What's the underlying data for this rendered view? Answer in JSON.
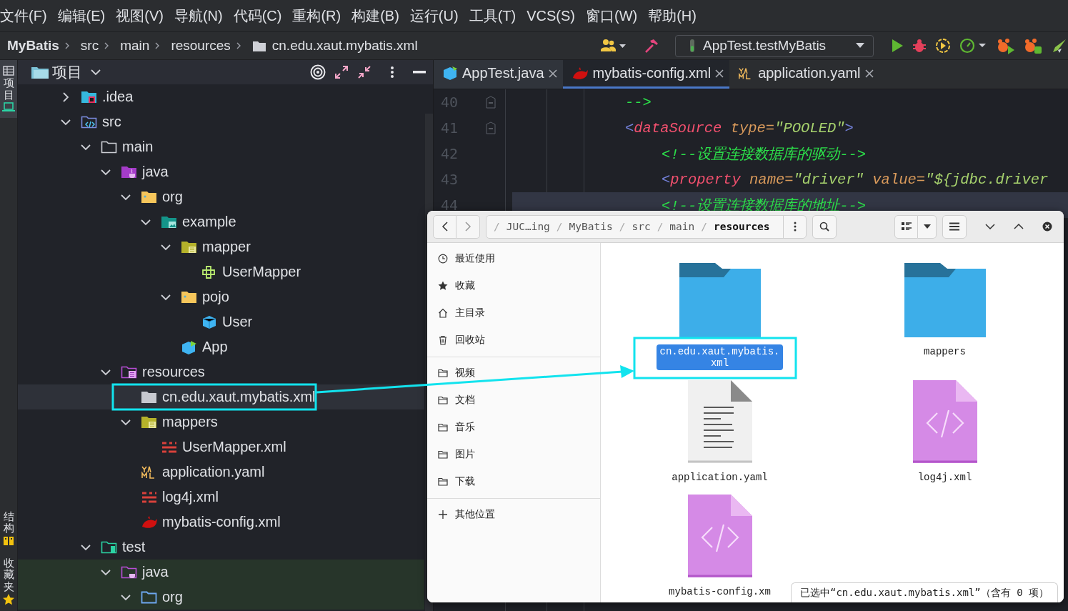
{
  "menu": [
    "文件(F)",
    "编辑(E)",
    "视图(V)",
    "导航(N)",
    "代码(C)",
    "重构(R)",
    "构建(B)",
    "运行(U)",
    "工具(T)",
    "VCS(S)",
    "窗口(W)",
    "帮助(H)"
  ],
  "breadcrumbs": [
    {
      "label": "MyBatis",
      "kind": "project"
    },
    {
      "label": "src",
      "kind": "dir"
    },
    {
      "label": "main",
      "kind": "dir"
    },
    {
      "label": "resources",
      "kind": "dir"
    },
    {
      "label": "cn.edu.xaut.mybatis.xml",
      "kind": "folder"
    }
  ],
  "run_config": {
    "label": "AppTest.testMyBatis"
  },
  "side_tabs": [
    {
      "label": "项目",
      "selected": true
    },
    {
      "label": "结构",
      "selected": false
    },
    {
      "label": "收藏夹",
      "selected": false
    }
  ],
  "project_panel": {
    "title": "项目",
    "tree": [
      {
        "label": ".idea",
        "kind": "idea-folder",
        "expanded": false,
        "selected": false
      },
      {
        "label": "src",
        "kind": "source-folder",
        "expanded": true,
        "selected": false,
        "children": [
          {
            "label": "main",
            "kind": "folder",
            "expanded": true,
            "selected": false,
            "children": [
              {
                "label": "java",
                "kind": "java-folder",
                "expanded": true,
                "selected": false,
                "children": [
                  {
                    "label": "org",
                    "kind": "package",
                    "expanded": true,
                    "selected": false,
                    "children": [
                      {
                        "label": "example",
                        "kind": "package-example",
                        "expanded": true,
                        "selected": false,
                        "children": [
                          {
                            "label": "mapper",
                            "kind": "package-mapper",
                            "expanded": true,
                            "selected": false,
                            "children": [
                              {
                                "label": "UserMapper",
                                "kind": "interface",
                                "selected": false
                              }
                            ]
                          },
                          {
                            "label": "pojo",
                            "kind": "package",
                            "expanded": true,
                            "selected": false,
                            "children": [
                              {
                                "label": "User",
                                "kind": "class",
                                "selected": false
                              }
                            ]
                          },
                          {
                            "label": "App",
                            "kind": "app-class",
                            "selected": false
                          }
                        ]
                      }
                    ]
                  }
                ]
              },
              {
                "label": "resources",
                "kind": "resources-folder",
                "expanded": true,
                "selected": false,
                "children": [
                  {
                    "label": "cn.edu.xaut.mybatis.xml",
                    "kind": "grey-folder",
                    "selected": true
                  },
                  {
                    "label": "mappers",
                    "kind": "package-mapper",
                    "expanded": true,
                    "selected": false,
                    "children": [
                      {
                        "label": "UserMapper.xml",
                        "kind": "xml",
                        "selected": false
                      }
                    ]
                  },
                  {
                    "label": "application.yaml",
                    "kind": "yaml",
                    "selected": false
                  },
                  {
                    "label": "log4j.xml",
                    "kind": "xml",
                    "selected": false
                  },
                  {
                    "label": "mybatis-config.xml",
                    "kind": "mybatis",
                    "selected": false
                  }
                ]
              }
            ]
          },
          {
            "label": "test",
            "kind": "test-folder",
            "expanded": true,
            "selected": false,
            "children": [
              {
                "label": "java",
                "kind": "test-java-folder",
                "expanded": true,
                "selected": false,
                "children": [
                  {
                    "label": "org",
                    "kind": "blue-folder",
                    "expanded": true,
                    "selected": false
                  }
                ]
              }
            ]
          }
        ]
      }
    ]
  },
  "editor": {
    "tabs": [
      {
        "label": "AppTest.java",
        "kind": "class",
        "selected": false
      },
      {
        "label": "mybatis-config.xml",
        "kind": "mybatis",
        "selected": true
      },
      {
        "label": "application.yaml",
        "kind": "yaml",
        "selected": false
      }
    ],
    "lines": [
      {
        "number": "40",
        "current": false,
        "fold": true,
        "tokens": [
          {
            "kind": "comment",
            "text": "-->"
          }
        ]
      },
      {
        "number": "41",
        "current": false,
        "fold": true,
        "tokens": [
          {
            "kind": "bracket",
            "text": "<"
          },
          {
            "kind": "tag",
            "text": "dataSource"
          },
          {
            "kind": "attr",
            "text": "type"
          },
          {
            "kind": "eq",
            "text": "="
          },
          {
            "kind": "string",
            "text": "\"POOLED\""
          },
          {
            "kind": "bracket",
            "text": ">"
          }
        ],
        "children": [
          {
            "number": "42",
            "current": false,
            "fold": false,
            "tokens": [
              {
                "kind": "comment",
                "text": "<!--设置连接数据库的驱动-->"
              }
            ]
          },
          {
            "number": "43",
            "current": false,
            "fold": false,
            "tokens": [
              {
                "kind": "bracket",
                "text": "<"
              },
              {
                "kind": "tag",
                "text": "property"
              },
              {
                "kind": "attr",
                "text": "name"
              },
              {
                "kind": "eq",
                "text": "="
              },
              {
                "kind": "string",
                "text": "\"driver\""
              },
              {
                "kind": "attr",
                "text": "value"
              },
              {
                "kind": "eq",
                "text": "="
              },
              {
                "kind": "string",
                "text": "\"${jdbc.driver"
              }
            ]
          },
          {
            "number": "44",
            "current": true,
            "fold": false,
            "tokens": [
              {
                "kind": "comment",
                "text": "<!--设置连接数据库的地址-->"
              }
            ]
          }
        ]
      }
    ]
  },
  "file_dialog": {
    "path": {
      "separator": "/",
      "segments": [
        {
          "label": "JUC…ing",
          "selected": false
        },
        {
          "label": "MyBatis",
          "selected": false
        },
        {
          "label": "src",
          "selected": false
        },
        {
          "label": "main",
          "selected": false
        },
        {
          "label": "resources",
          "selected": true
        }
      ]
    },
    "place_groups": [
      {
        "items": [
          {
            "label": "最近使用",
            "kind": "recent"
          },
          {
            "label": "收藏",
            "kind": "star"
          },
          {
            "label": "主目录",
            "kind": "home"
          },
          {
            "label": "回收站",
            "kind": "trash"
          }
        ]
      },
      {
        "items": [
          {
            "label": "视频",
            "kind": "folder"
          },
          {
            "label": "文档",
            "kind": "folder"
          },
          {
            "label": "音乐",
            "kind": "folder"
          },
          {
            "label": "图片",
            "kind": "folder"
          },
          {
            "label": "下载",
            "kind": "folder"
          }
        ]
      },
      {
        "items": [
          {
            "label": "其他位置",
            "kind": "plus"
          }
        ]
      }
    ],
    "files": [
      {
        "name": "cn.edu.xaut.mybatis.xml",
        "kind": "folder",
        "selected": true
      },
      {
        "name": "mappers",
        "kind": "folder",
        "selected": false
      },
      {
        "name": "application.yaml",
        "kind": "text",
        "selected": false
      },
      {
        "name": "log4j.xml",
        "kind": "xml",
        "selected": false
      },
      {
        "name": "mybatis-config.xm",
        "kind": "xml",
        "selected": false
      }
    ],
    "status": "已选中“cn.edu.xaut.mybatis.xml”（含有 0 项）"
  }
}
